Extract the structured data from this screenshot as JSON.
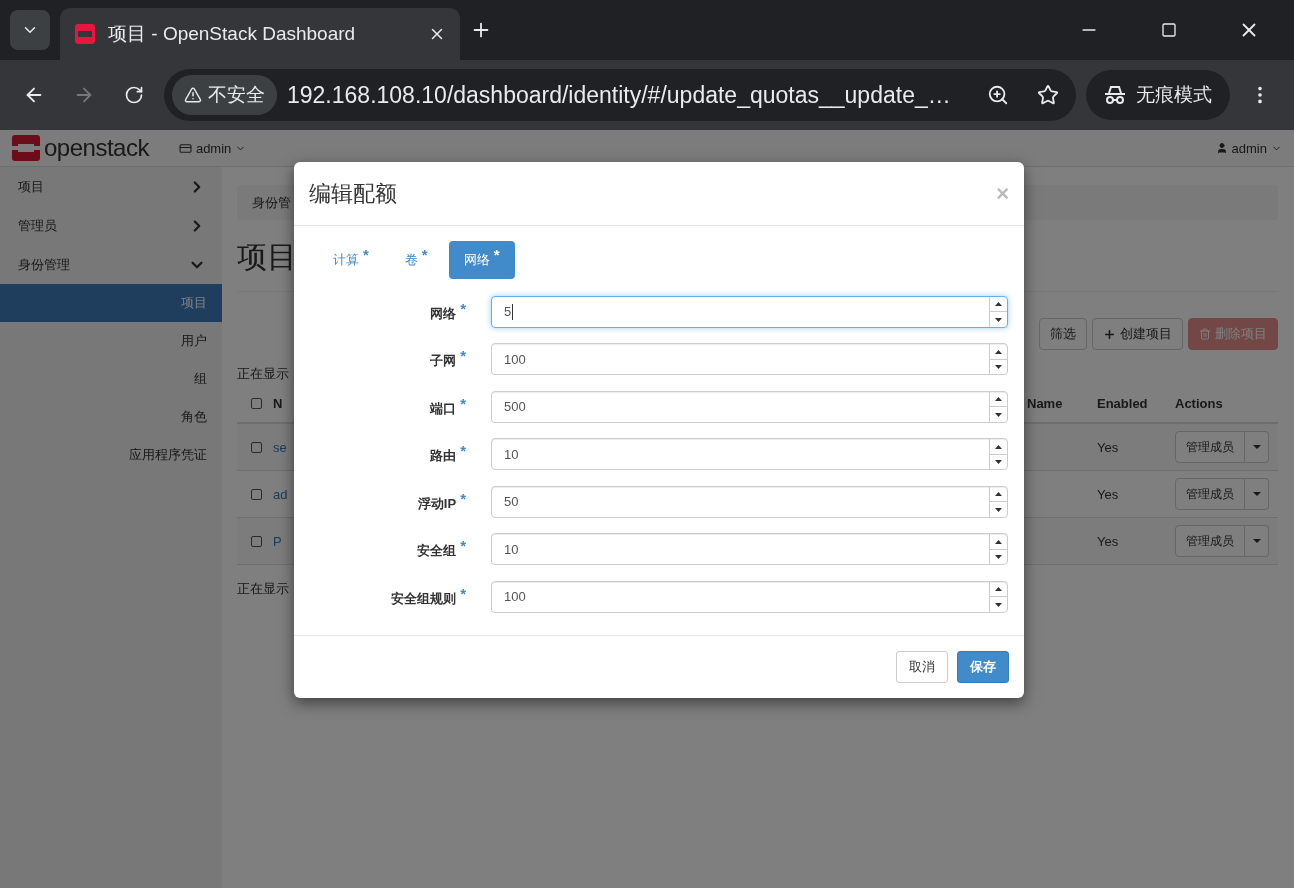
{
  "browser": {
    "tab_title": "项目 - OpenStack Dashboard",
    "security": "不安全",
    "url": "192.168.108.10/dashboard/identity/#/update_quotas__update_…",
    "incognito": "无痕模式"
  },
  "header": {
    "brand": "openstack",
    "project": "admin",
    "user": "admin"
  },
  "sidebar": [
    {
      "label": "项目",
      "expanded": false
    },
    {
      "label": "管理员",
      "expanded": false
    },
    {
      "label": "身份管理",
      "expanded": true,
      "children": [
        {
          "label": "项目",
          "selected": true
        },
        {
          "label": "用户",
          "selected": false
        },
        {
          "label": "组",
          "selected": false
        },
        {
          "label": "角色",
          "selected": false
        },
        {
          "label": "应用程序凭证",
          "selected": false
        }
      ]
    }
  ],
  "page": {
    "breadcrumb": "身份管",
    "title": "项目",
    "actions": [
      {
        "label": "筛选",
        "kind": "default",
        "disabled": false
      },
      {
        "label": "创建项目",
        "kind": "create",
        "disabled": false
      },
      {
        "label": "删除项目",
        "kind": "danger",
        "disabled": true
      }
    ],
    "info": "正在显示",
    "select_all_checked": false,
    "columns": [
      "N",
      "Name",
      "Enabled",
      "Actions"
    ],
    "rows": [
      {
        "checked": false,
        "name": "se",
        "enabled": "Yes",
        "action": "管理成员"
      },
      {
        "checked": false,
        "name": "ad",
        "enabled": "Yes",
        "action": "管理成员"
      },
      {
        "checked": false,
        "name": "P",
        "enabled": "Yes",
        "action": "管理成员"
      }
    ],
    "footer": "正在显示"
  },
  "modal": {
    "title": "编辑配额",
    "close": "×",
    "tabs": [
      {
        "label": "计算",
        "marker": "*",
        "selected": false
      },
      {
        "label": "卷",
        "marker": "*",
        "selected": false
      },
      {
        "label": "网络",
        "marker": "*",
        "selected": true
      }
    ],
    "fields": [
      {
        "label": "网络",
        "marker": "*",
        "value": "5",
        "focused": true
      },
      {
        "label": "子网",
        "marker": "*",
        "value": "100",
        "focused": false
      },
      {
        "label": "端口",
        "marker": "*",
        "value": "500",
        "focused": false
      },
      {
        "label": "路由",
        "marker": "*",
        "value": "10",
        "focused": false
      },
      {
        "label": "浮动IP",
        "marker": "*",
        "value": "50",
        "focused": false
      },
      {
        "label": "安全组",
        "marker": "*",
        "value": "10",
        "focused": false
      },
      {
        "label": "安全组规则",
        "marker": "*",
        "value": "100",
        "focused": false
      }
    ],
    "buttons": [
      {
        "label": "取消",
        "kind": "default"
      },
      {
        "label": "保存",
        "kind": "primary"
      }
    ]
  }
}
